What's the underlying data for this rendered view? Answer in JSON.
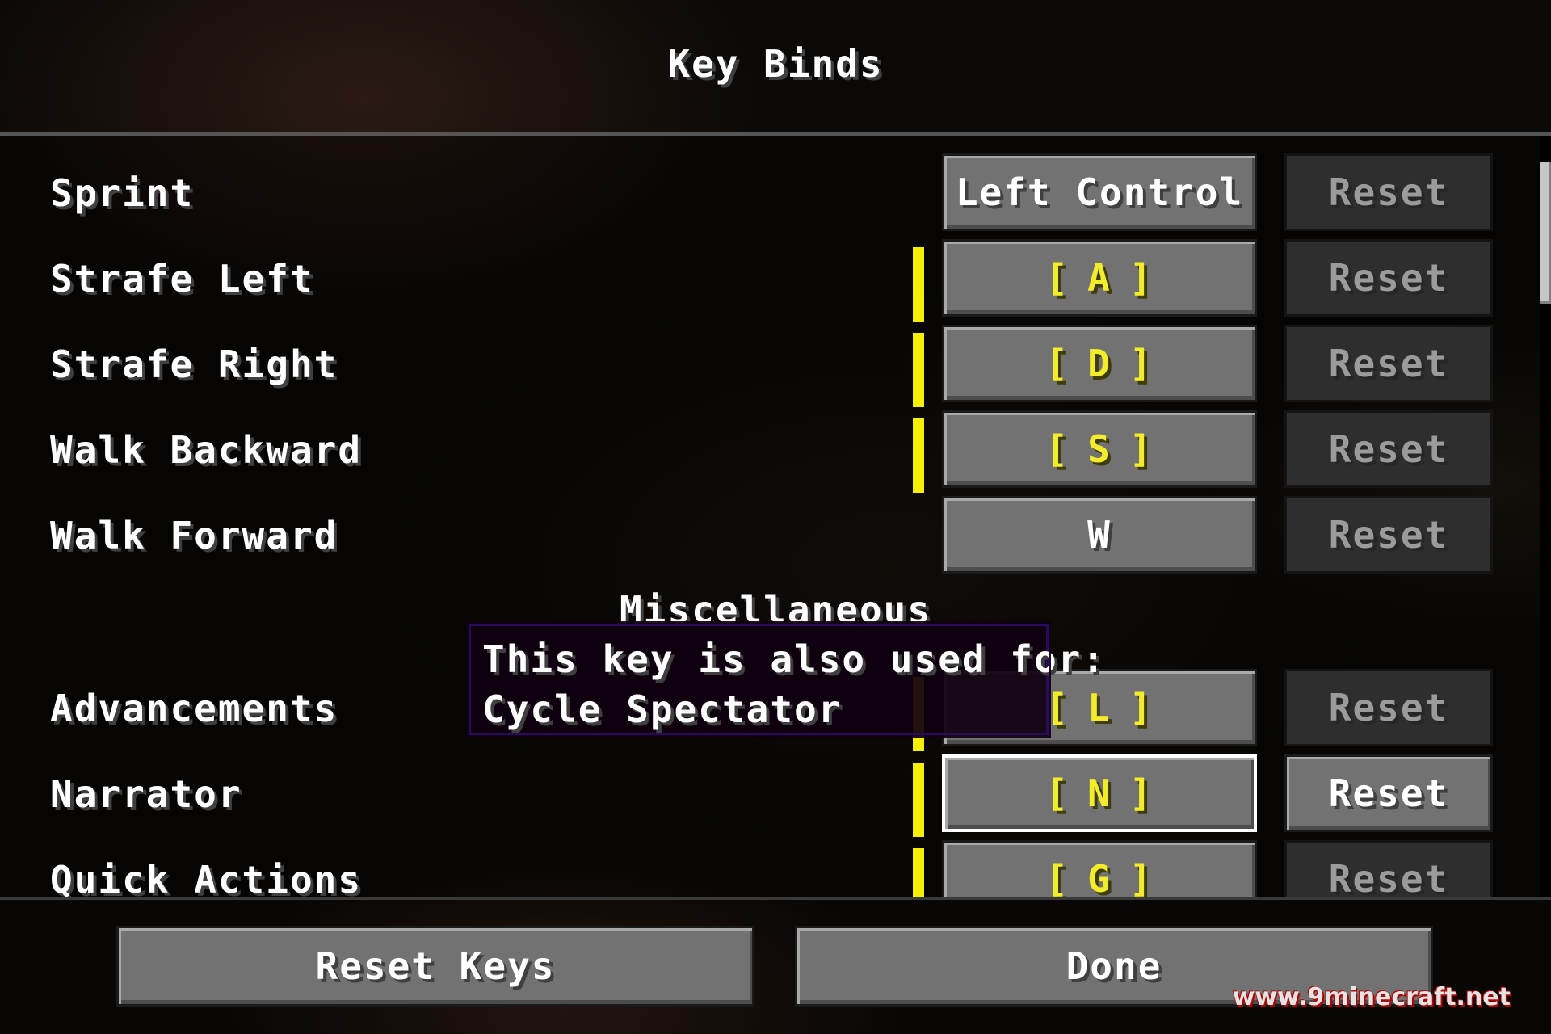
{
  "screen": {
    "title": "Key Binds"
  },
  "keybinds": [
    {
      "action": "Sprint",
      "key": "Left Control",
      "reset": "Reset"
    },
    {
      "action": "Strafe Left",
      "key": "A",
      "reset": "Reset"
    },
    {
      "action": "Strafe Right",
      "key": "D",
      "reset": "Reset"
    },
    {
      "action": "Walk Backward",
      "key": "S",
      "reset": "Reset"
    },
    {
      "action": "Walk Forward",
      "key": "W",
      "reset": "Reset"
    }
  ],
  "category": {
    "name": "Miscellaneous"
  },
  "misc_keybinds": [
    {
      "action": "Advancements",
      "key": "L",
      "reset": "Reset"
    },
    {
      "action": "Narrator",
      "key": "N",
      "reset": "Reset"
    },
    {
      "action": "Quick Actions",
      "key": "G",
      "reset": "Reset"
    }
  ],
  "tooltip": {
    "line1": "This key is also used for:",
    "line2": "Cycle Spectator"
  },
  "footer": {
    "reset_keys_label": "Reset Keys",
    "done_label": "Done"
  },
  "watermark": "www.9minecraft.net",
  "colors": {
    "conflict": "#f5ef00",
    "button": "#727272",
    "button_disabled": "#2e2e2e"
  }
}
